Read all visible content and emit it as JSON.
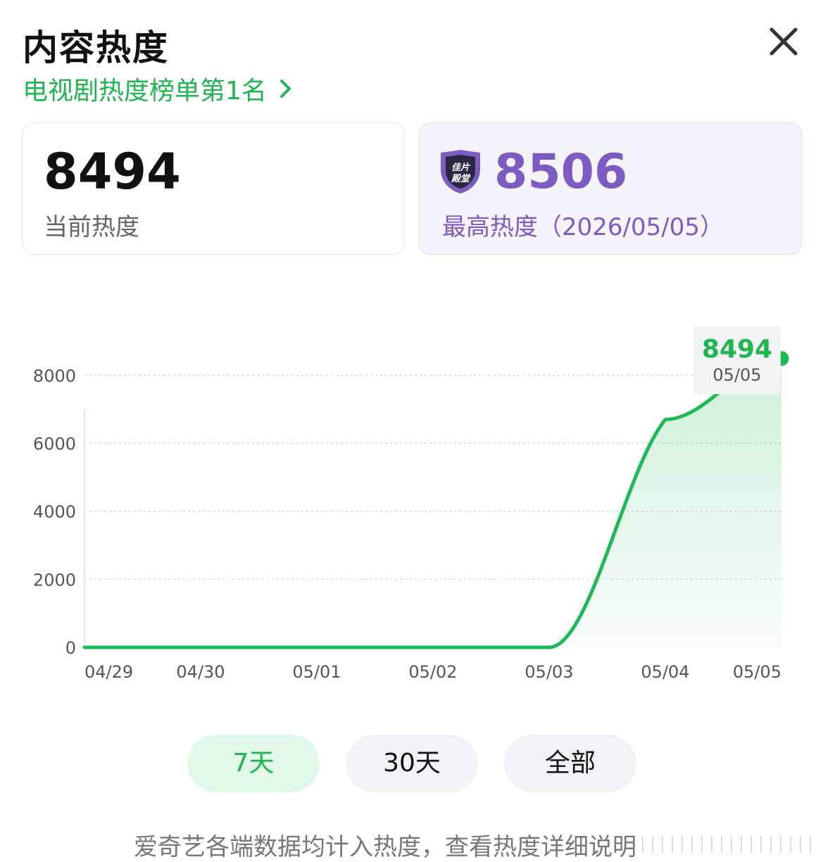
{
  "header": {
    "title": "内容热度",
    "rank_text": "电视剧热度榜单第1名"
  },
  "cards": {
    "current": {
      "value": "8494",
      "label": "当前热度"
    },
    "peak": {
      "value": "8506",
      "label": "最高热度（2026/05/05）",
      "badge_text": [
        "佳片",
        "殿堂"
      ]
    }
  },
  "chart_data": {
    "type": "area",
    "x": [
      "04/29",
      "04/30",
      "05/01",
      "05/02",
      "05/03",
      "05/04",
      "05/05"
    ],
    "values": [
      0,
      0,
      0,
      0,
      0,
      6700,
      8494
    ],
    "y_ticks": [
      0,
      2000,
      4000,
      6000,
      8000
    ],
    "ylim": [
      0,
      9000
    ],
    "grid": true,
    "line_color": "#1db954",
    "tooltip": {
      "value": "8494",
      "date": "05/05"
    }
  },
  "ranges": [
    {
      "label": "7天",
      "active": true
    },
    {
      "label": "30天",
      "active": false
    },
    {
      "label": "全部",
      "active": false
    }
  ],
  "footer": {
    "note": "爱奇艺各端数据均计入热度，查看热度详细说明"
  },
  "colors": {
    "accent": "#1fb650",
    "peak": "#7c5bc2"
  }
}
